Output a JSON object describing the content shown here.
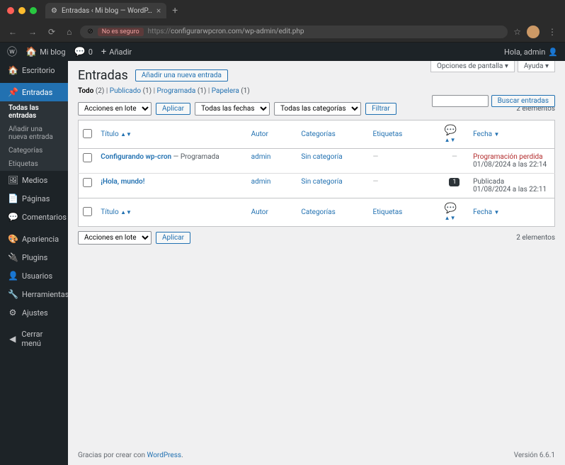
{
  "browser": {
    "tab_title": "Entradas ‹ Mi blog — WordP…",
    "url_warning": "No es seguro",
    "url_prefix": "https://",
    "url": "configurarwpcron.com/wp-admin/edit.php"
  },
  "adminbar": {
    "site_name": "Mi blog",
    "comments": "0",
    "add_new": "Añadir",
    "howdy": "Hola, admin"
  },
  "sidebar": {
    "items": [
      {
        "icon": "🏠",
        "label": "Escritorio"
      },
      {
        "icon": "📌",
        "label": "Entradas",
        "active": true
      },
      {
        "icon": "🖼",
        "label": "Medios"
      },
      {
        "icon": "📄",
        "label": "Páginas"
      },
      {
        "icon": "💬",
        "label": "Comentarios"
      },
      {
        "icon": "🎨",
        "label": "Apariencia"
      },
      {
        "icon": "🔌",
        "label": "Plugins"
      },
      {
        "icon": "👤",
        "label": "Usuarios"
      },
      {
        "icon": "🔧",
        "label": "Herramientas"
      },
      {
        "icon": "⚙",
        "label": "Ajustes"
      },
      {
        "icon": "◀",
        "label": "Cerrar menú"
      }
    ],
    "submenu": [
      {
        "label": "Todas las entradas",
        "current": true
      },
      {
        "label": "Añadir una nueva entrada"
      },
      {
        "label": "Categorías"
      },
      {
        "label": "Etiquetas"
      }
    ]
  },
  "screen_meta": {
    "options": "Opciones de pantalla ▾",
    "help": "Ayuda ▾"
  },
  "page": {
    "heading": "Entradas",
    "add_new": "Añadir una nueva entrada"
  },
  "filters": {
    "views": [
      {
        "label": "Todo",
        "count": "(2)",
        "current": true
      },
      {
        "label": "Publicado",
        "count": "(1)"
      },
      {
        "label": "Programada",
        "count": "(1)"
      },
      {
        "label": "Papelera",
        "count": "(1)"
      }
    ],
    "bulk": "Acciones en lote",
    "apply": "Aplicar",
    "dates": "Todas las fechas",
    "cats": "Todas las categorías",
    "filter": "Filtrar",
    "search_btn": "Buscar entradas",
    "items_count": "2 elementos"
  },
  "table": {
    "headers": {
      "title": "Título",
      "author": "Autor",
      "categories": "Categorías",
      "tags": "Etiquetas",
      "date": "Fecha"
    },
    "rows": [
      {
        "title": "Configurando wp-cron",
        "status": " — Programada",
        "author": "admin",
        "category": "Sin categoría",
        "tags": "—",
        "comments": "—",
        "date_status": "Programación perdida",
        "date_status_class": "missed",
        "date": "01/08/2024 a las 22:14"
      },
      {
        "title": "¡Hola, mundo!",
        "status": "",
        "author": "admin",
        "category": "Sin categoría",
        "tags": "—",
        "comments": "1",
        "date_status": "Publicada",
        "date_status_class": "",
        "date": "01/08/2024 a las 22:11"
      }
    ]
  },
  "footer": {
    "thanks_pre": "Gracias por crear con ",
    "wp": "WordPress",
    "thanks_post": ".",
    "version": "Versión 6.6.1"
  }
}
